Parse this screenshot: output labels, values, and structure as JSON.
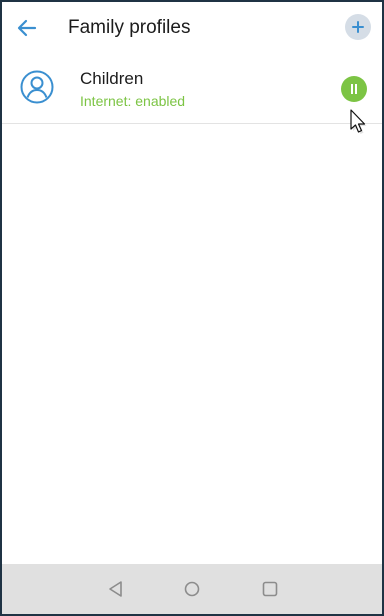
{
  "app_bar": {
    "title": "Family profiles",
    "back_icon": "arrow-left-icon",
    "add_icon": "plus-icon"
  },
  "profiles": [
    {
      "name": "Children",
      "status": "Internet: enabled",
      "avatar_icon": "user-circle-icon",
      "action_icon": "pause-icon"
    }
  ],
  "nav_bar": {
    "icons": [
      "back-triangle-icon",
      "home-circle-icon",
      "recents-square-icon"
    ]
  },
  "colors": {
    "accent_blue": "#3a8fd0",
    "status_green": "#7cc444",
    "add_button_bg": "#d5dde6",
    "nav_bar_bg": "#e0e0e0",
    "nav_icon": "#8c8c8c"
  }
}
